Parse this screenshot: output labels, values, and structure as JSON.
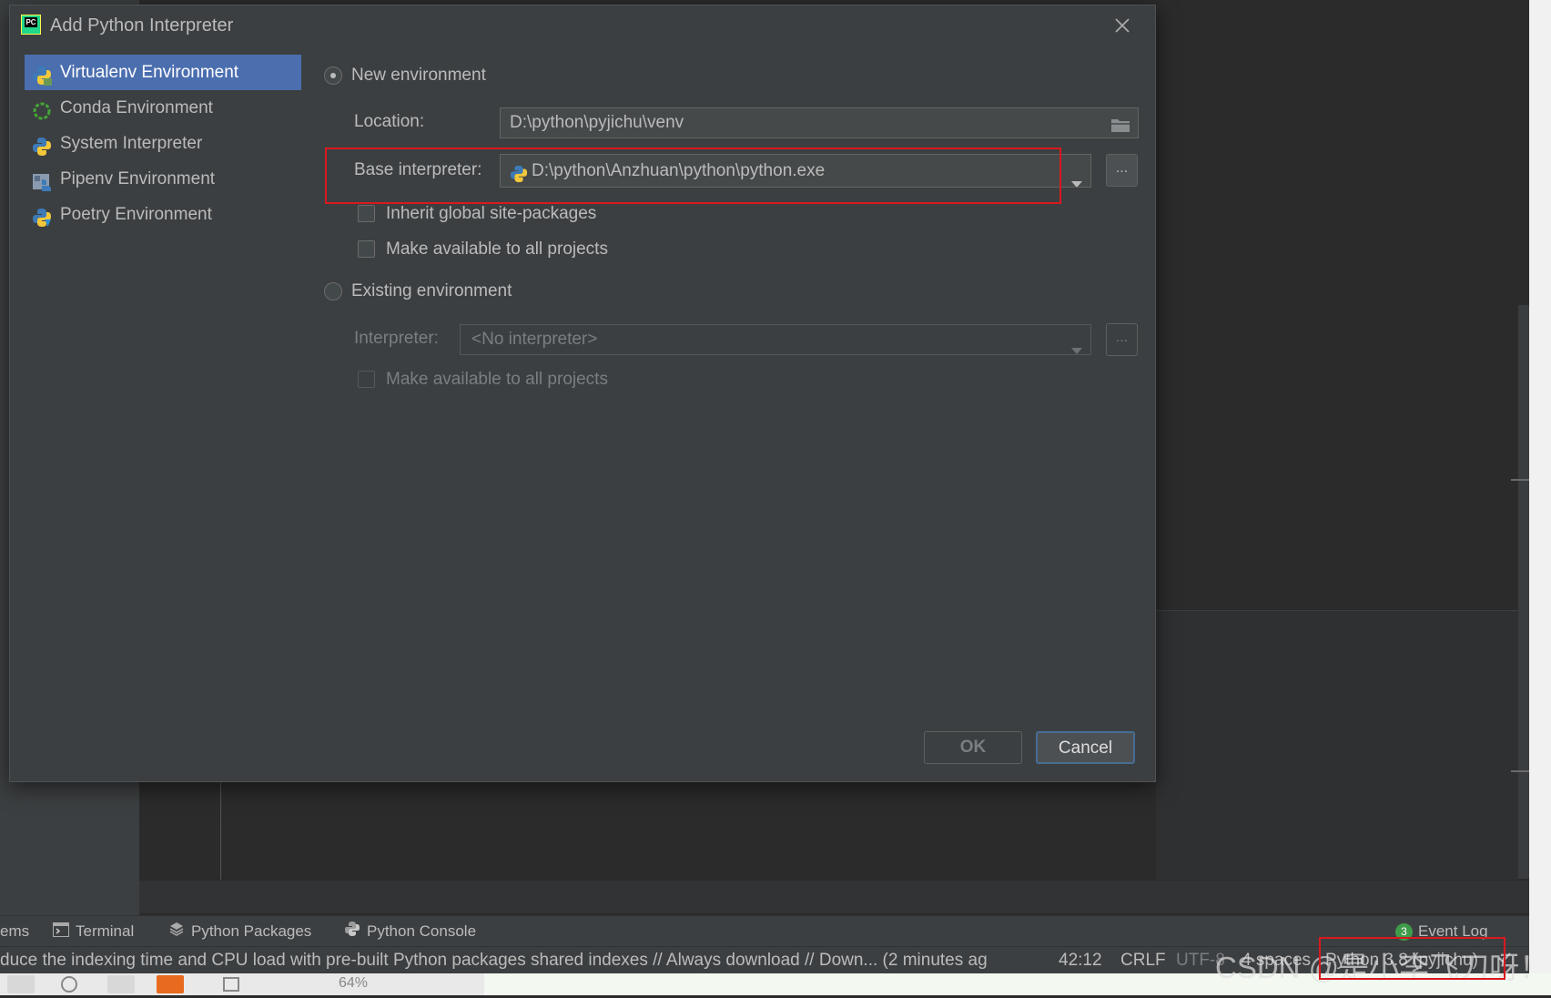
{
  "dialog": {
    "title": "Add Python Interpreter",
    "sidebar": {
      "items": [
        {
          "label": "Virtualenv Environment",
          "icon": "virtualenv-icon",
          "selected": true
        },
        {
          "label": "Conda Environment",
          "icon": "conda-icon",
          "selected": false
        },
        {
          "label": "System Interpreter",
          "icon": "python-icon",
          "selected": false
        },
        {
          "label": "Pipenv Environment",
          "icon": "pipenv-icon",
          "selected": false
        },
        {
          "label": "Poetry Environment",
          "icon": "poetry-icon",
          "selected": false
        }
      ]
    },
    "new_env": {
      "radio_label": "New environment",
      "selected": true,
      "location_label": "Location:",
      "location_value": "D:\\python\\pyjichu\\venv",
      "base_label": "Base interpreter:",
      "base_value": "D:\\python\\Anzhuan\\python\\python.exe",
      "browse_label": "...",
      "inherit_label": "Inherit global site-packages",
      "inherit_checked": false,
      "available_label": "Make available to all projects",
      "available_checked": false
    },
    "existing_env": {
      "radio_label": "Existing environment",
      "selected": false,
      "interpreter_label": "Interpreter:",
      "interpreter_value": "<No interpreter>",
      "browse_label": "...",
      "available_label": "Make available to all projects",
      "available_checked": false
    },
    "buttons": {
      "ok": "OK",
      "cancel": "Cancel"
    }
  },
  "tool_bar": {
    "problems_fragment": "ems",
    "terminal": "Terminal",
    "python_packages": "Python Packages",
    "python_console": "Python Console",
    "event_log_count": "3",
    "event_log": "Event Log"
  },
  "status_bar": {
    "message": "duce the indexing time and CPU load with pre-built Python packages shared indexes // Always download // Down... (2 minutes ag",
    "position": "42:12",
    "line_separator": "CRLF",
    "encoding": "UTF-8",
    "indent": "4 spaces",
    "interpreter": "Python 3.8 (pyjichu)"
  },
  "bottom_toolbar": {
    "zoom": "64%"
  },
  "watermark": "CSDN @是小李飞刀呀！",
  "colors": {
    "selection": "#4b6eaf",
    "dialog_bg": "#3c3f41",
    "highlight_box": "#d9191f",
    "text": "#bbbbbb"
  }
}
